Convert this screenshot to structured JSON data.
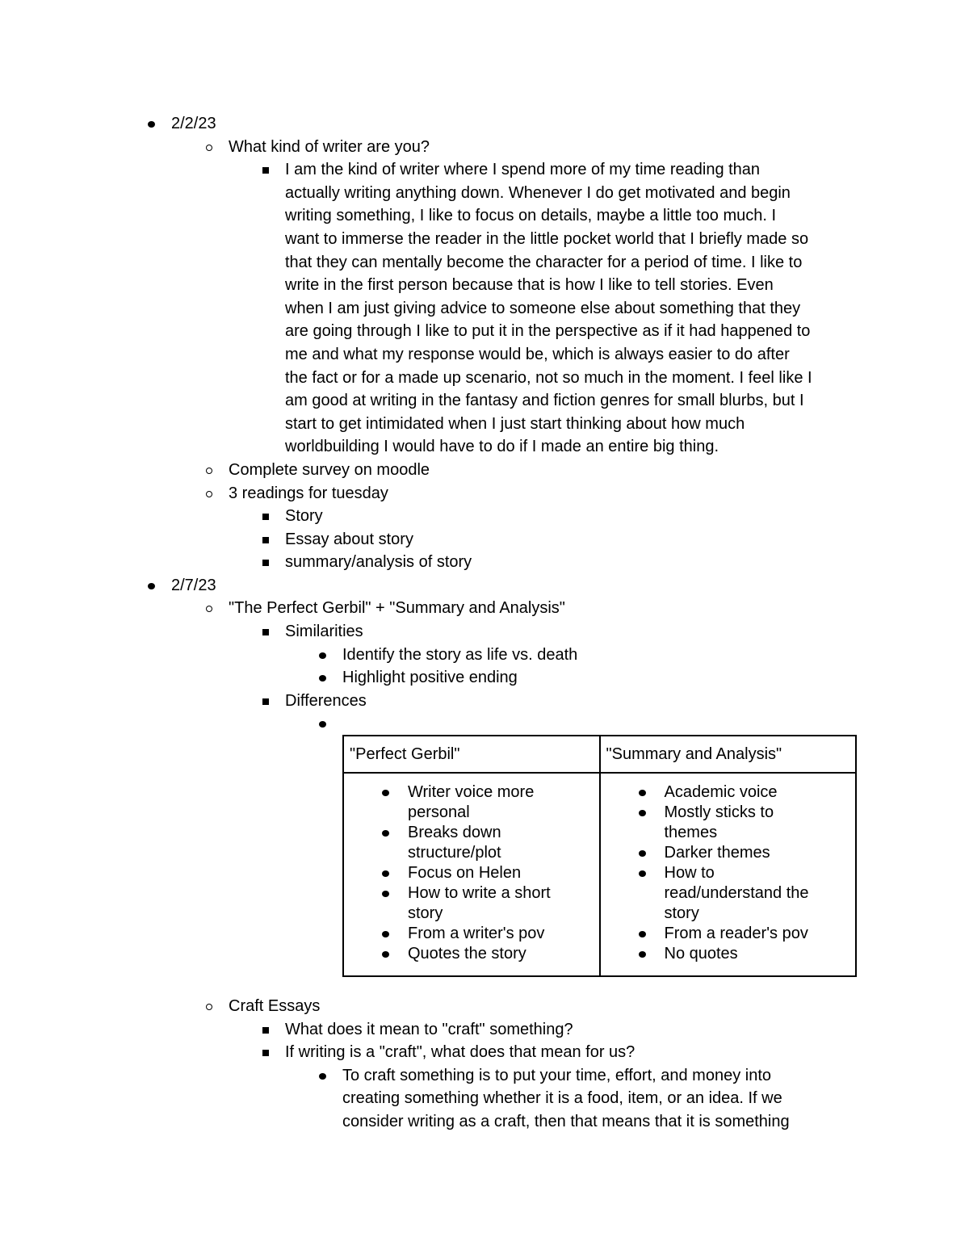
{
  "lines_before_table": [
    {
      "level": 1,
      "text": "2/2/23"
    },
    {
      "level": 2,
      "text": "What kind of writer are you?"
    },
    {
      "level": 3,
      "text": "I am the kind of writer where I spend more of my time reading than"
    },
    {
      "level": 3,
      "cont": true,
      "text": "actually writing anything down. Whenever I do get motivated and begin"
    },
    {
      "level": 3,
      "cont": true,
      "text": "writing something, I like to focus on details, maybe a little too much. I"
    },
    {
      "level": 3,
      "cont": true,
      "text": "want to immerse the reader in the little pocket world that I briefly made so"
    },
    {
      "level": 3,
      "cont": true,
      "text": "that they can mentally become the character for a period of time. I like to"
    },
    {
      "level": 3,
      "cont": true,
      "text": "write in the first person because that is how I like to tell stories. Even"
    },
    {
      "level": 3,
      "cont": true,
      "text": "when I am just giving advice to someone else about something that they"
    },
    {
      "level": 3,
      "cont": true,
      "text": "are going through I like to put it in the perspective as if it had happened to"
    },
    {
      "level": 3,
      "cont": true,
      "text": "me and what my response would be, which is always easier to do after"
    },
    {
      "level": 3,
      "cont": true,
      "text": "the fact or for a made up scenario, not so much in the moment. I feel like I"
    },
    {
      "level": 3,
      "cont": true,
      "text": "am good at writing in the fantasy and fiction genres for small blurbs, but I"
    },
    {
      "level": 3,
      "cont": true,
      "text": "start to get intimidated when I just start thinking about how much"
    },
    {
      "level": 3,
      "cont": true,
      "text": "worldbuilding I would have to do if I made an entire big thing."
    },
    {
      "level": 2,
      "text": "Complete survey on moodle"
    },
    {
      "level": 2,
      "text": "3 readings for tuesday"
    },
    {
      "level": 3,
      "text": "Story"
    },
    {
      "level": 3,
      "text": "Essay about story"
    },
    {
      "level": 3,
      "text": "summary/analysis of story"
    },
    {
      "level": 1,
      "text": "2/7/23"
    },
    {
      "level": 2,
      "text": "\"The Perfect Gerbil\" + \"Summary and Analysis\""
    },
    {
      "level": 3,
      "text": "Similarities"
    },
    {
      "level": 4,
      "text": "Identify the story as life vs. death"
    },
    {
      "level": 4,
      "text": "Highlight positive ending"
    },
    {
      "level": 3,
      "text": "Differences"
    },
    {
      "level": 4,
      "text": ""
    }
  ],
  "table": {
    "headers": [
      "\"Perfect Gerbil\"",
      "\"Summary and Analysis\""
    ],
    "columns": [
      [
        "Writer voice more personal",
        "Breaks down structure/plot",
        "Focus on Helen",
        "How to write a short story",
        "From a writer's pov",
        "Quotes the story"
      ],
      [
        "Academic voice",
        "Mostly sticks to themes",
        "Darker themes",
        "How to read/understand the story",
        "From a reader's pov",
        "No quotes"
      ]
    ]
  },
  "lines_after_table": [
    {
      "level": 2,
      "text": "Craft Essays"
    },
    {
      "level": 3,
      "text": "What does it mean to \"craft\" something?"
    },
    {
      "level": 3,
      "text": "If writing is a \"craft\", what does that mean for us?"
    },
    {
      "level": 4,
      "text": "To craft something is to put your time, effort, and money into"
    },
    {
      "level": 4,
      "cont": true,
      "text": "creating something whether it is a food, item, or an idea. If we"
    },
    {
      "level": 4,
      "cont": true,
      "text": "consider writing as a craft, then that means that it is something"
    }
  ]
}
